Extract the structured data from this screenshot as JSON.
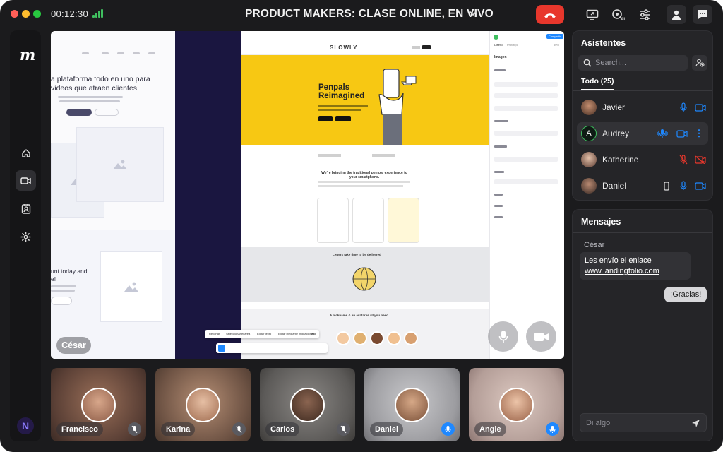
{
  "window": {
    "timer": "00:12:30",
    "title": "PRODUCT MAKERS: CLASE ONLINE, EN VIVO",
    "colors": {
      "end_call": "#e8372c",
      "signal": "#3fbf5f",
      "accent": "#1e88ff",
      "danger": "#e8372c"
    }
  },
  "toolbar": {
    "icons": [
      "share-screen-icon",
      "ai-icon",
      "settings-sliders-icon",
      "user-icon",
      "chat-icon"
    ],
    "ai_label": "AI"
  },
  "sidebar": {
    "logo": "m",
    "items": [
      "home-icon",
      "video-icon",
      "contact-icon",
      "gear-icon"
    ],
    "active": "video-icon",
    "brand_logo": "N"
  },
  "stage": {
    "presenter_name": "César",
    "shared_screen": {
      "left_headline_line1": "a plataforma todo en uno para",
      "left_headline_line2": "videos que atraen clientes",
      "left_lower_line1": "unt today and",
      "left_lower_line2": "e!",
      "site_brand": "SLOWLY",
      "hero_line1": "Penpals",
      "hero_line2": "Reimagined",
      "section_heading": "We're bringing the traditional pen pal experience to your smartphone.",
      "letters_heading": "Letters take time to be delivered",
      "stamp_heading": "A nickname & an avatar is all you need",
      "panel_button": "Compartir",
      "panel_tab1": "Diseño",
      "panel_tab2": "Prototipo",
      "panel_zoom": "50%",
      "panel_section": "Imagen",
      "toolbar_items": [
        "Recortar",
        "Seleccionar el área",
        "Editar texto",
        "Editar mediante indicaciones",
        "Más"
      ]
    }
  },
  "participants": [
    {
      "name": "Francisco",
      "mic": "muted"
    },
    {
      "name": "Karina",
      "mic": "muted"
    },
    {
      "name": "Carlos",
      "mic": "muted"
    },
    {
      "name": "Daniel",
      "mic": "active"
    },
    {
      "name": "Angie",
      "mic": "active"
    }
  ],
  "attendees": {
    "title": "Asistentes",
    "search_placeholder": "Search...",
    "tab_label": "Todo (25)",
    "people": [
      {
        "name": "Javier",
        "avatar": "photo",
        "mic": "on",
        "camera": "on"
      },
      {
        "name": "Audrey",
        "avatar": "A",
        "mic": "speaking",
        "camera": "on",
        "more": "⋮"
      },
      {
        "name": "Katherine",
        "avatar": "photo",
        "mic": "off",
        "camera": "off"
      },
      {
        "name": "Daniel",
        "avatar": "photo",
        "device": "phone-icon",
        "mic": "on",
        "camera": "on"
      }
    ]
  },
  "messages": {
    "title": "Mensajes",
    "sender": "César",
    "incoming_line1": "Les envío el enlace",
    "incoming_link": "www.landingfolio.com",
    "outgoing": "¡Gracias!",
    "input_placeholder": "Di algo"
  }
}
